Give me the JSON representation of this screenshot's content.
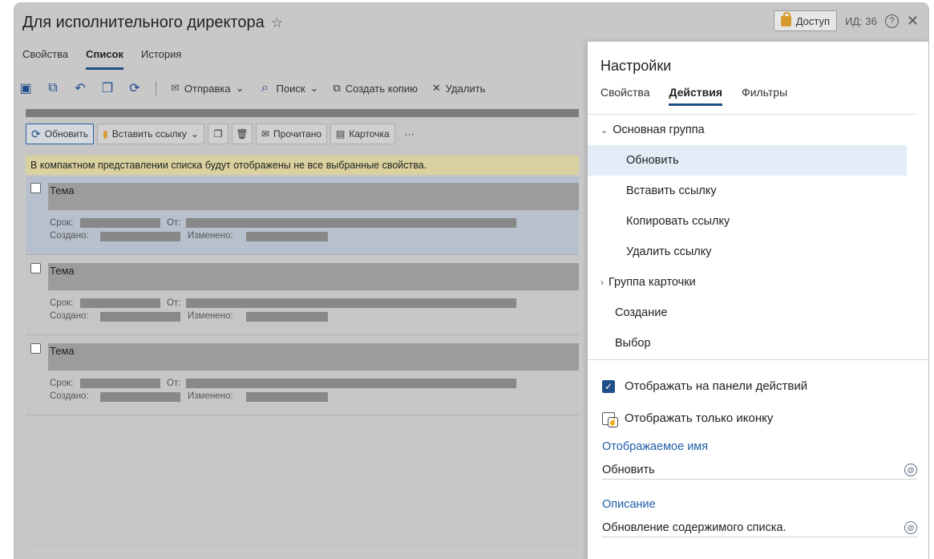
{
  "window": {
    "title": "Для исполнительного директора",
    "access_label": "Доступ",
    "id_label": "ИД: 36"
  },
  "tabs": [
    "Свойства",
    "Список",
    "История"
  ],
  "active_tab": "Список",
  "toolbar": {
    "send_label": "Отправка",
    "search_label": "Поиск",
    "copy_label": "Создать копию",
    "delete_label": "Удалить"
  },
  "inner_toolbar": {
    "refresh_label": "Обновить",
    "insert_link_label": "Вставить ссылку",
    "read_label": "Прочитано",
    "card_label": "Карточка",
    "more_label": "···"
  },
  "notice": "В компактном представлении списка будут отображены не все выбранные свойства.",
  "list_items": [
    {
      "topic": "Тема",
      "due_label": "Срок:",
      "from_label": "От:",
      "created_label": "Создано:",
      "modified_label": "Изменено:",
      "selected": true
    },
    {
      "topic": "Тема",
      "due_label": "Срок:",
      "from_label": "От:",
      "created_label": "Создано:",
      "modified_label": "Изменено:",
      "selected": false
    },
    {
      "topic": "Тема",
      "due_label": "Срок:",
      "from_label": "От:",
      "created_label": "Создано:",
      "modified_label": "Изменено:",
      "selected": false
    }
  ],
  "panel": {
    "title": "Настройки",
    "tabs": [
      "Свойства",
      "Действия",
      "Фильтры"
    ],
    "active_tab": "Действия",
    "groups": [
      {
        "label": "Основная группа",
        "expanded": true,
        "children": [
          "Обновить",
          "Вставить ссылку",
          "Копировать ссылку",
          "Удалить ссылку"
        ],
        "selected_child": "Обновить"
      },
      {
        "label": "Группа карточки",
        "expanded": false
      },
      {
        "label": "Создание"
      },
      {
        "label": "Выбор"
      }
    ],
    "show_on_panel_label": "Отображать на панели действий",
    "show_on_panel_checked": true,
    "icon_only_label": "Отображать только иконку",
    "icon_only_checked": false,
    "display_name_label": "Отображаемое имя",
    "display_name_value": "Обновить",
    "description_label": "Описание",
    "description_value": "Обновление содержимого списка."
  },
  "colors": {
    "accent": "#1f4f8a",
    "selected_row": "#e2edf8",
    "notice_bg": "#d9d19f",
    "link_label": "#1f5fa8"
  }
}
